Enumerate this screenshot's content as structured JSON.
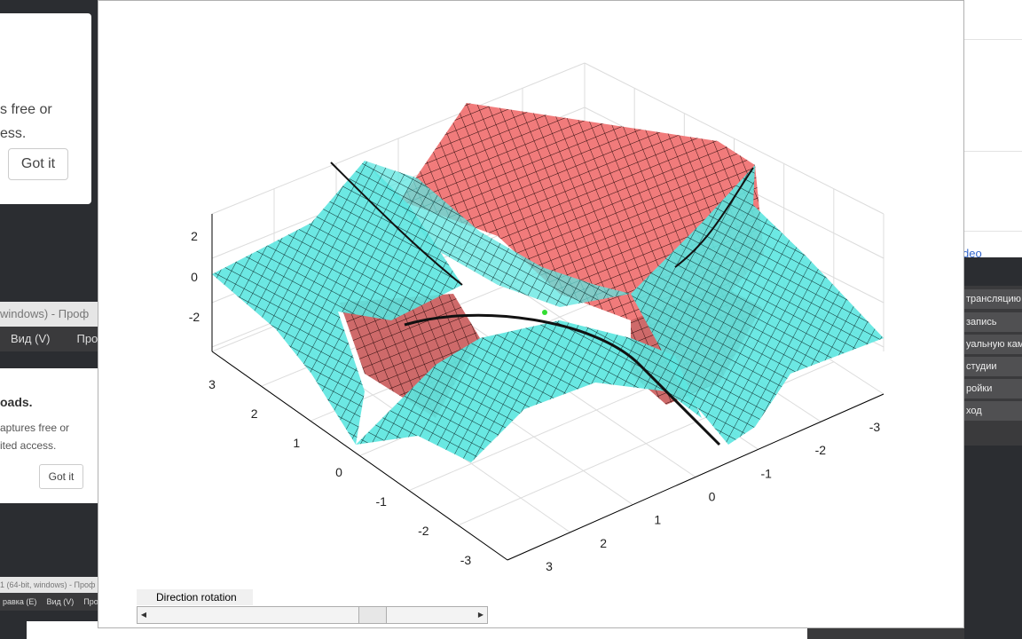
{
  "background": {
    "top_toast": {
      "line1": "s free or",
      "line2": "ess.",
      "button": "Got it"
    },
    "obs_title": "windows) - Проф",
    "obs_menu": [
      "Вид (V)",
      "Проф"
    ],
    "mid_toast": {
      "heading": "oads.",
      "line1": "aptures free or",
      "line2": "ited access.",
      "button": "Got it"
    },
    "obs_title_small": "1 (64-bit, windows) - Проф",
    "obs_menu_small": [
      "равка (E)",
      "Вид (V)",
      "Проф"
    ],
    "right_link": "deo",
    "obs_dock": [
      "трансляцию",
      "запись",
      "уальную камеру",
      "студии",
      "ройки",
      "ход"
    ]
  },
  "figure": {
    "slider": {
      "label": "Direction rotation",
      "left_arrow": "◀",
      "right_arrow": "▶",
      "value": 0.7
    },
    "colors": {
      "cyan": "#5ce6e0",
      "red": "#f07070",
      "grid": "#dcdcdc",
      "axis": "#000000"
    },
    "chart_data": {
      "type": "surface3d",
      "xlabel": "",
      "ylabel": "",
      "zlabel": "",
      "x_ticks": [
        "-3",
        "-2",
        "-1",
        "0",
        "1",
        "2",
        "3"
      ],
      "y_ticks": [
        "3",
        "2",
        "1",
        "0",
        "-1",
        "-2",
        "-3"
      ],
      "z_ticks": [
        "2",
        "0",
        "-2"
      ],
      "xlim": [
        -3,
        3
      ],
      "ylim": [
        -3,
        3
      ],
      "zlim": [
        -2.5,
        2.5
      ],
      "grid": true,
      "series": [
        {
          "color": "cyan",
          "surface": "saddle surfaces (4 lobes)"
        },
        {
          "color": "red",
          "surface": "translucent surface"
        }
      ]
    }
  }
}
